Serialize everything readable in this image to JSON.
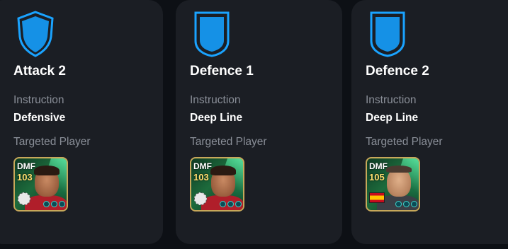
{
  "colors": {
    "background": "#0d1015",
    "card": "#1b1e24",
    "accent": "#1aa3ff",
    "label": "#8a8f98",
    "value": "#ffffff",
    "rating": "#ffe070",
    "card_border": "#c7a85a"
  },
  "cards": [
    {
      "icon": "shield-icon",
      "title": "Attack 2",
      "instruction_label": "Instruction",
      "instruction_value": "Defensive",
      "targeted_label": "Targeted Player",
      "player": {
        "position": "DMF",
        "rating": "103",
        "badge": "club-crest-icon"
      }
    },
    {
      "icon": "defence-shield-icon",
      "title": "Defence 1",
      "instruction_label": "Instruction",
      "instruction_value": "Deep Line",
      "targeted_label": "Targeted Player",
      "player": {
        "position": "DMF",
        "rating": "103",
        "badge": "club-crest-icon"
      }
    },
    {
      "icon": "defence-shield-icon",
      "title": "Defence 2",
      "instruction_label": "Instruction",
      "instruction_value": "Deep Line",
      "targeted_label": "Targeted Player",
      "player": {
        "position": "DMF",
        "rating": "105",
        "badge": "spain-flag-icon"
      }
    }
  ]
}
